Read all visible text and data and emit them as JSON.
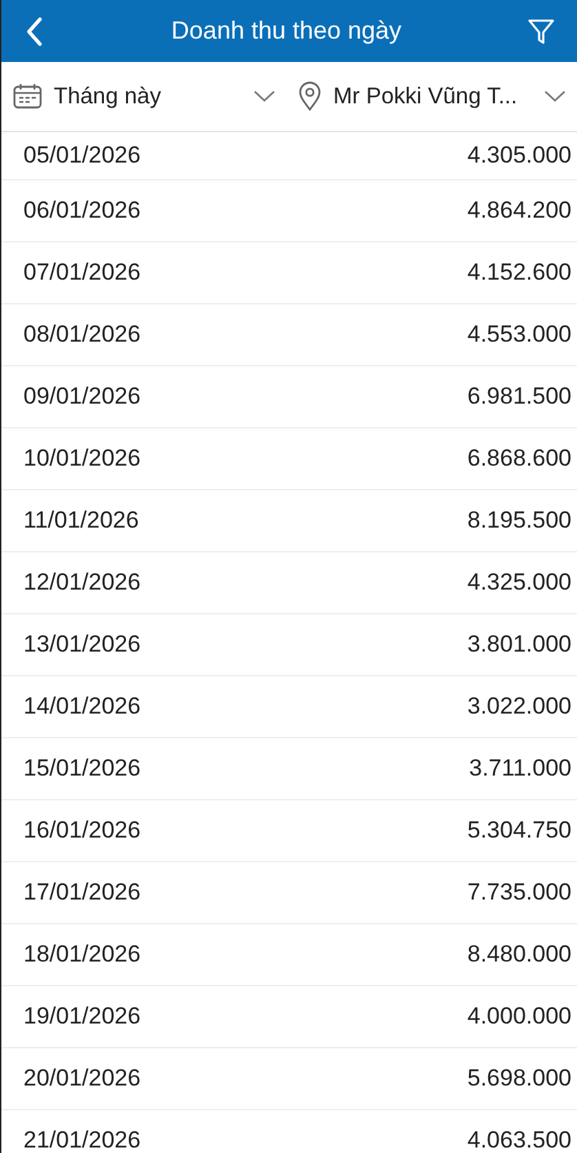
{
  "header": {
    "title": "Doanh thu theo ngày"
  },
  "filters": {
    "period": "Tháng này",
    "store": "Mr Pokki Vũng T..."
  },
  "rows": [
    {
      "date": "05/01/2026",
      "amount": "4.305.000"
    },
    {
      "date": "06/01/2026",
      "amount": "4.864.200"
    },
    {
      "date": "07/01/2026",
      "amount": "4.152.600"
    },
    {
      "date": "08/01/2026",
      "amount": "4.553.000"
    },
    {
      "date": "09/01/2026",
      "amount": "6.981.500"
    },
    {
      "date": "10/01/2026",
      "amount": "6.868.600"
    },
    {
      "date": "11/01/2026",
      "amount": "8.195.500"
    },
    {
      "date": "12/01/2026",
      "amount": "4.325.000"
    },
    {
      "date": "13/01/2026",
      "amount": "3.801.000"
    },
    {
      "date": "14/01/2026",
      "amount": "3.022.000"
    },
    {
      "date": "15/01/2026",
      "amount": "3.711.000"
    },
    {
      "date": "16/01/2026",
      "amount": "5.304.750"
    },
    {
      "date": "17/01/2026",
      "amount": "7.735.000"
    },
    {
      "date": "18/01/2026",
      "amount": "8.480.000"
    },
    {
      "date": "19/01/2026",
      "amount": "4.000.000"
    },
    {
      "date": "20/01/2026",
      "amount": "5.698.000"
    },
    {
      "date": "21/01/2026",
      "amount": "4.063.500"
    }
  ]
}
